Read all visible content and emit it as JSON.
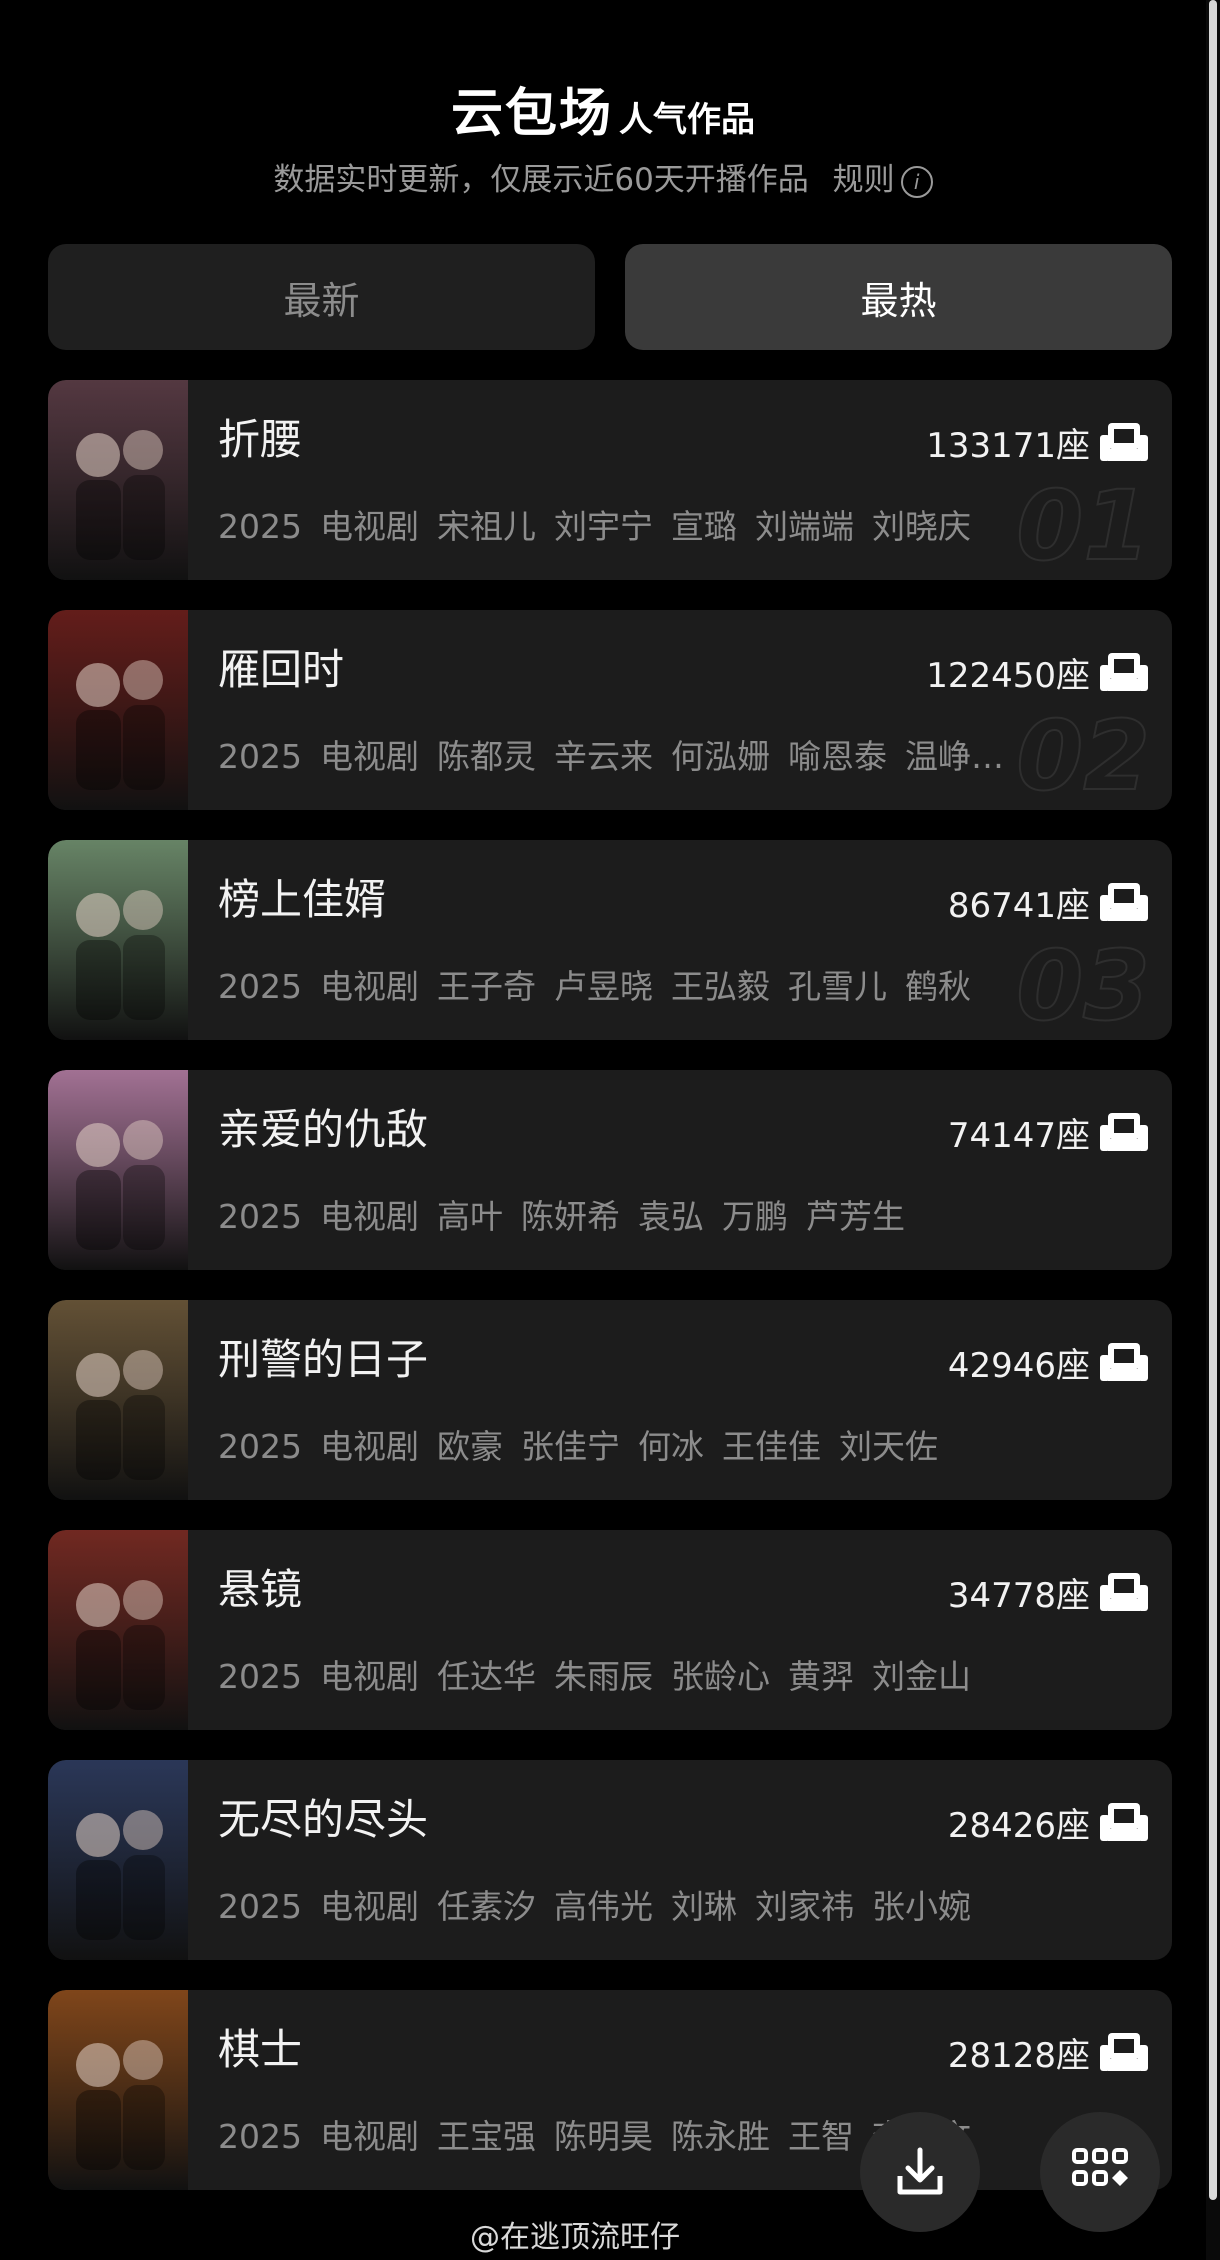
{
  "header": {
    "title_main": "云包场",
    "title_sub": "人气作品",
    "subtitle": "数据实时更新，仅展示近60天开播作品",
    "rules_label": "规则"
  },
  "tabs": [
    {
      "label": "最新",
      "active": false
    },
    {
      "label": "最热",
      "active": true
    }
  ],
  "items": [
    {
      "rank": "01",
      "title": "折腰",
      "seats": "133171座",
      "year": "2025",
      "type": "电视剧",
      "cast": [
        "宋祖儿",
        "刘宇宁",
        "宣璐",
        "刘端端",
        "刘晓庆"
      ],
      "poster_color": "#5a3b45"
    },
    {
      "rank": "02",
      "title": "雁回时",
      "seats": "122450座",
      "year": "2025",
      "type": "电视剧",
      "cast": [
        "陈都灵",
        "辛云来",
        "何泓姗",
        "喻恩泰",
        "温峥…"
      ],
      "poster_color": "#6b1d1a"
    },
    {
      "rank": "03",
      "title": "榜上佳婿",
      "seats": "86741座",
      "year": "2025",
      "type": "电视剧",
      "cast": [
        "王子奇",
        "卢昱晓",
        "王弘毅",
        "孔雪儿",
        "鹤秋"
      ],
      "poster_color": "#6f8f6e"
    },
    {
      "rank": "",
      "title": "亲爱的仇敌",
      "seats": "74147座",
      "year": "2025",
      "type": "电视剧",
      "cast": [
        "高叶",
        "陈妍希",
        "袁弘",
        "万鹏",
        "芦芳生"
      ],
      "poster_color": "#b07aa0"
    },
    {
      "rank": "",
      "title": "刑警的日子",
      "seats": "42946座",
      "year": "2025",
      "type": "电视剧",
      "cast": [
        "欧豪",
        "张佳宁",
        "何冰",
        "王佳佳",
        "刘天佐"
      ],
      "poster_color": "#6a5638"
    },
    {
      "rank": "",
      "title": "悬镜",
      "seats": "34778座",
      "year": "2025",
      "type": "电视剧",
      "cast": [
        "任达华",
        "朱雨辰",
        "张龄心",
        "黄羿",
        "刘金山"
      ],
      "poster_color": "#7a2a22"
    },
    {
      "rank": "",
      "title": "无尽的尽头",
      "seats": "28426座",
      "year": "2025",
      "type": "电视剧",
      "cast": [
        "任素汐",
        "高伟光",
        "刘琳",
        "刘家祎",
        "张小婉"
      ],
      "poster_color": "#2c3a5e"
    },
    {
      "rank": "",
      "title": "棋士",
      "seats": "28128座",
      "year": "2025",
      "type": "电视剧",
      "cast": [
        "王宝强",
        "陈明昊",
        "陈永胜",
        "王智",
        "李乃文"
      ],
      "poster_color": "#8a4a1a"
    }
  ],
  "watermark": "@在逃顶流旺仔",
  "icons": {
    "seat": "couch-icon",
    "download": "download-icon",
    "grid": "grid-menu-icon",
    "info": "info-icon"
  }
}
